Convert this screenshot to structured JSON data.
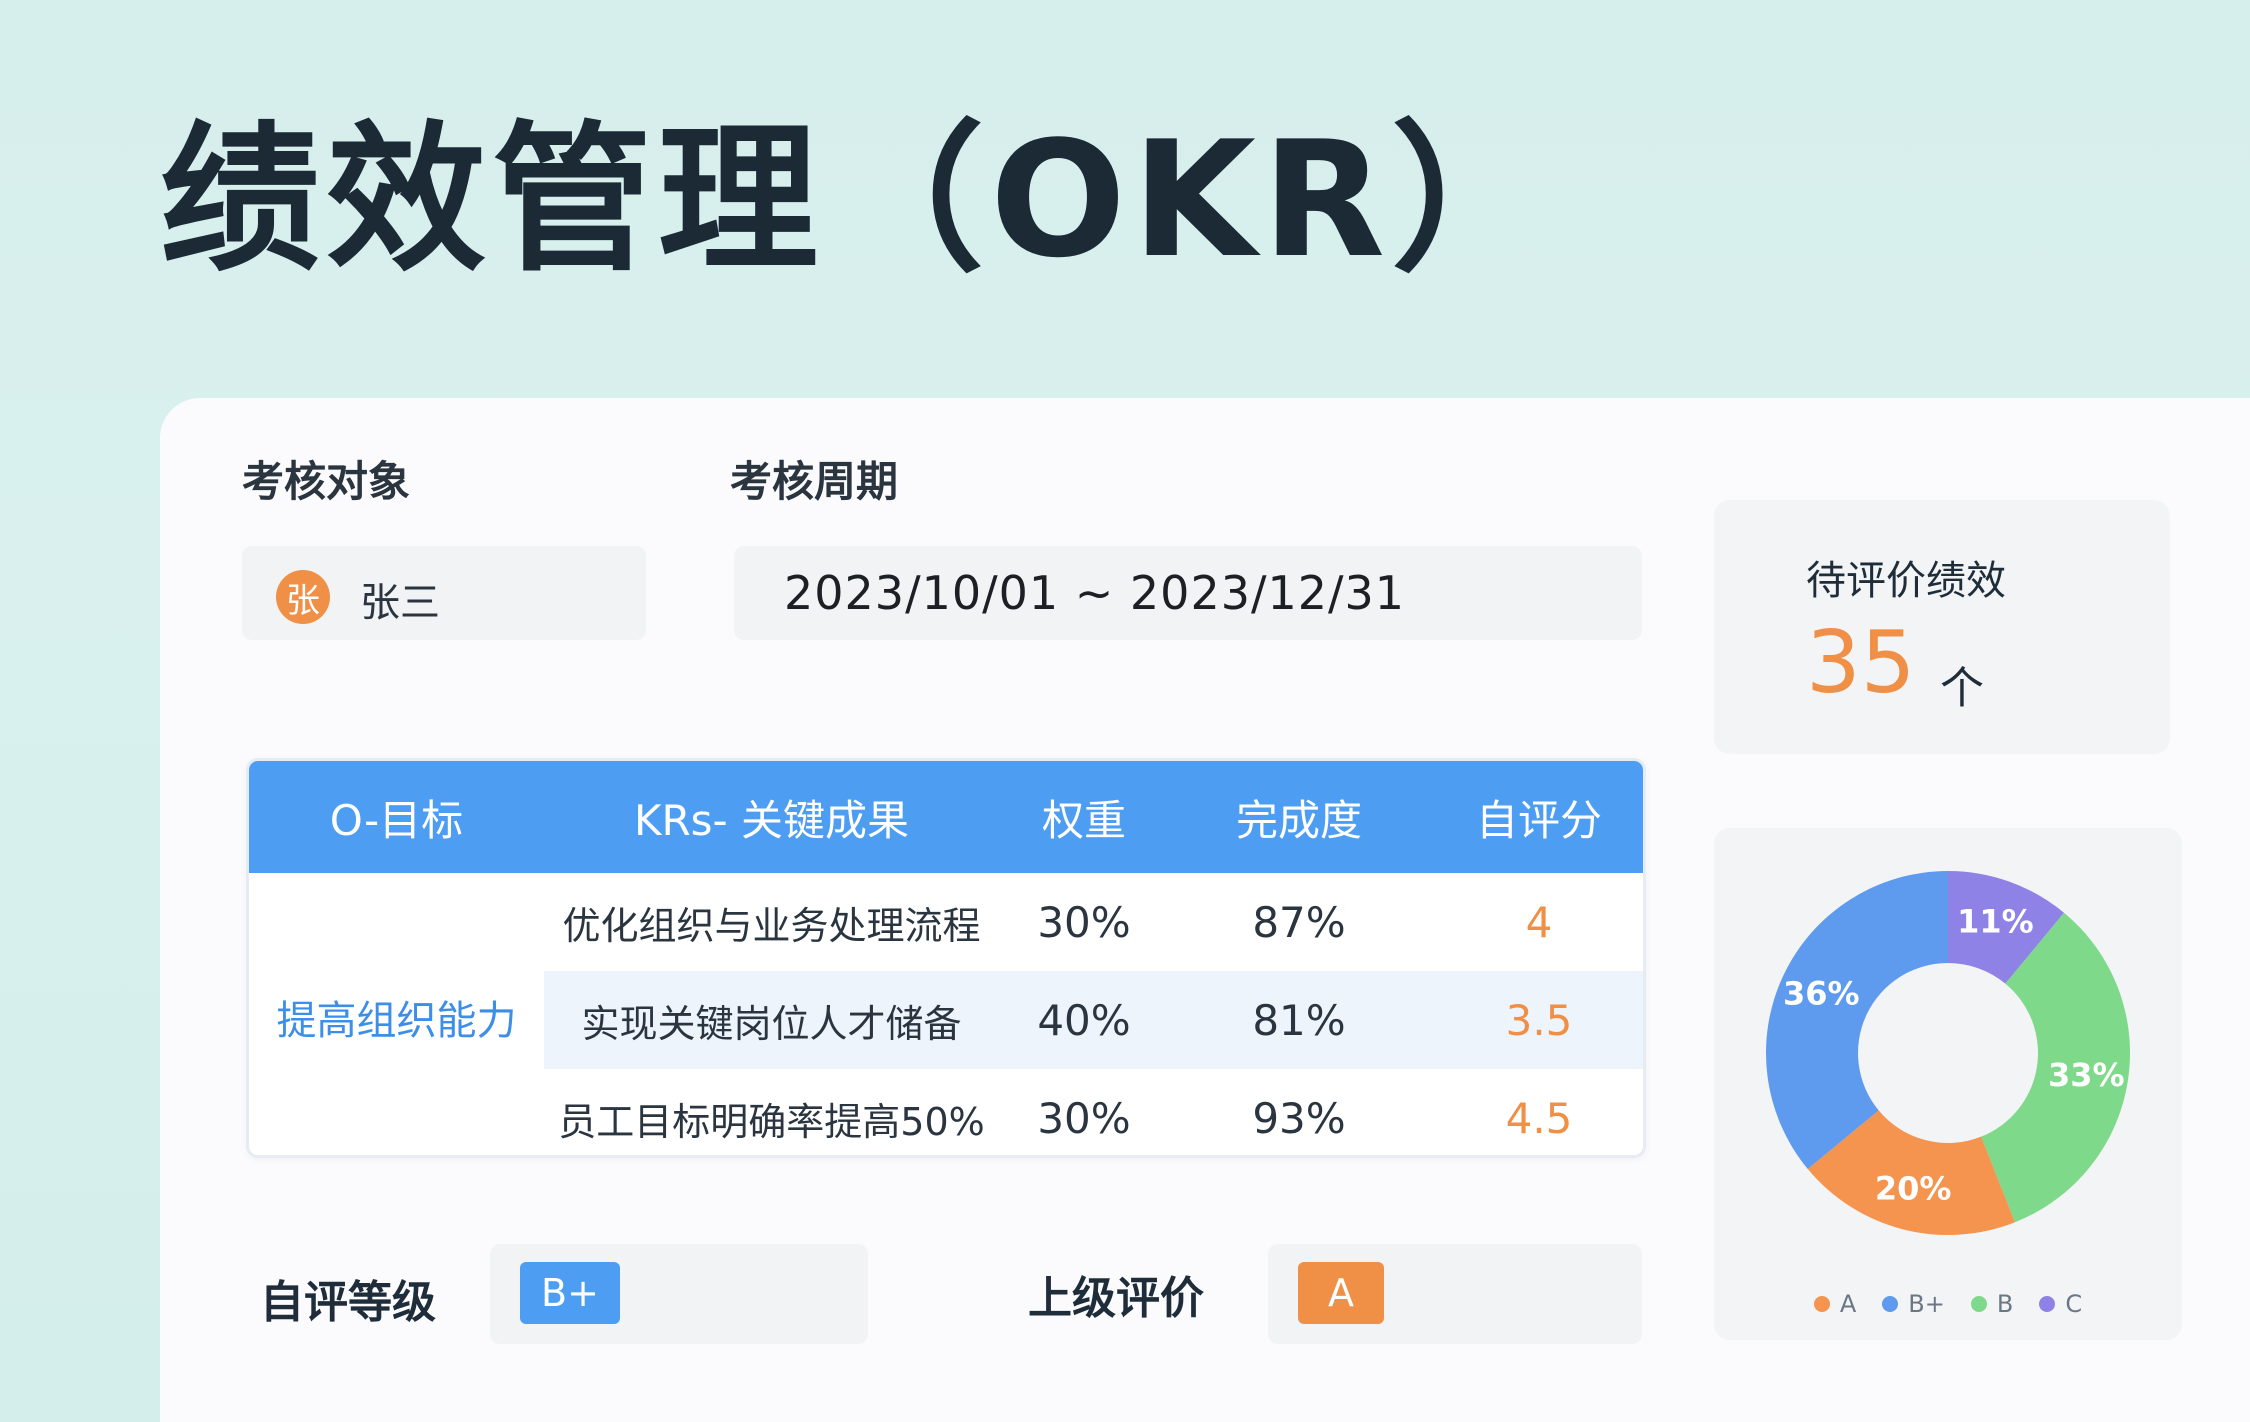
{
  "page": {
    "title": "绩效管理（OKR）"
  },
  "review_target": {
    "label": "考核对象",
    "avatar_char": "张",
    "name": "张三"
  },
  "review_period": {
    "label": "考核周期",
    "value": "2023/10/01 ~ 2023/12/31"
  },
  "table": {
    "headers": [
      "O-目标",
      "KRs- 关键成果",
      "权重",
      "完成度",
      "自评分"
    ],
    "objective": "提高组织能力",
    "rows": [
      {
        "kr": "优化组织与业务处理流程",
        "weight": "30%",
        "completion": "87%",
        "score": "4"
      },
      {
        "kr": "实现关键岗位人才储备",
        "weight": "40%",
        "completion": "81%",
        "score": "3.5"
      },
      {
        "kr": "员工目标明确率提高50%",
        "weight": "30%",
        "completion": "93%",
        "score": "4.5"
      }
    ]
  },
  "self_grade": {
    "label": "自评等级",
    "value": "B+"
  },
  "supervisor_eval": {
    "label": "上级评价",
    "value": "A"
  },
  "pending": {
    "label": "待评价绩效",
    "value": "35",
    "unit": "个"
  },
  "chart_data": {
    "type": "pie",
    "categories": [
      "A",
      "B+",
      "B",
      "C"
    ],
    "values": [
      20,
      36,
      33,
      11
    ],
    "labels": [
      "20%",
      "36%",
      "33%",
      "11%"
    ],
    "colors": [
      "#f4944e",
      "#5e9bef",
      "#7fd98a",
      "#8e82e6"
    ],
    "legend": "bottom"
  }
}
